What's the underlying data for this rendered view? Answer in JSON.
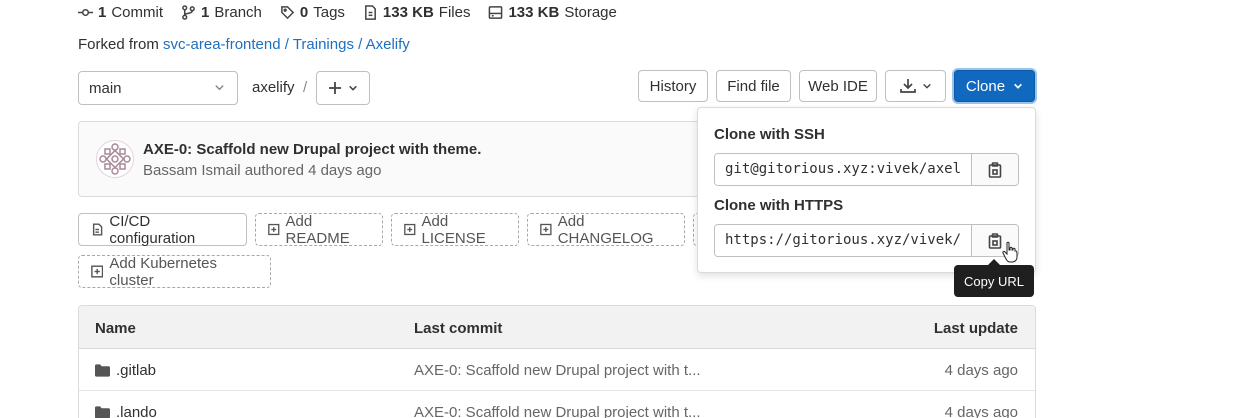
{
  "stats": {
    "commits": "1",
    "commits_label": "Commit",
    "branches": "1",
    "branches_label": "Branch",
    "tags": "0",
    "tags_label": "Tags",
    "files_size": "133 KB",
    "files_label": "Files",
    "storage_size": "133 KB",
    "storage_label": "Storage"
  },
  "fork": {
    "prefix": "Forked from",
    "source": "svc-area-frontend / Trainings / Axelify"
  },
  "toolbar": {
    "branch": "main",
    "path": "axelify",
    "separator": "/",
    "history": "History",
    "find_file": "Find file",
    "web_ide": "Web IDE",
    "clone": "Clone"
  },
  "commit": {
    "title": "AXE-0: Scaffold new Drupal project with theme.",
    "meta": "Bassam Ismail authored 4 days ago"
  },
  "actions": {
    "cicd": "CI/CD configuration",
    "readme": "Add README",
    "license": "Add LICENSE",
    "changelog": "Add CHANGELOG",
    "kubernetes": "Add Kubernetes cluster"
  },
  "table": {
    "headers": {
      "name": "Name",
      "last_commit": "Last commit",
      "last_update": "Last update"
    },
    "rows": [
      {
        "name": ".gitlab",
        "commit": "AXE-0: Scaffold new Drupal project with t...",
        "updated": "4 days ago"
      },
      {
        "name": ".lando",
        "commit": "AXE-0: Scaffold new Drupal project with t...",
        "updated": "4 days ago"
      }
    ]
  },
  "clone_dropdown": {
    "ssh_label": "Clone with SSH",
    "ssh_url": "git@gitorious.xyz:vivek/axel",
    "https_label": "Clone with HTTPS",
    "https_url": "https://gitorious.xyz/vivek/",
    "tooltip": "Copy URL"
  },
  "colors": {
    "primary": "#1068bf",
    "link": "#1f6fbf"
  }
}
